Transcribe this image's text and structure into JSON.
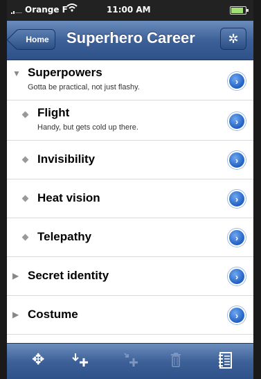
{
  "status_bar": {
    "carrier": "Orange F",
    "time": "11:00 AM",
    "wifi_icon": "wifi-icon",
    "battery_icon": "battery-icon"
  },
  "nav": {
    "back_label": "Home",
    "title": "Superhero Career",
    "settings_icon": "gear-icon"
  },
  "list": {
    "rows": [
      {
        "title": "Superpowers",
        "subtitle": "Gotta be practical, not just flashy.",
        "marker": "expanded-triangle",
        "level": 0
      },
      {
        "title": "Flight",
        "subtitle": "Handy, but gets cold up there.",
        "marker": "diamond",
        "level": 1
      },
      {
        "title": "Invisibility",
        "subtitle": "",
        "marker": "diamond",
        "level": 1
      },
      {
        "title": "Heat vision",
        "subtitle": "",
        "marker": "diamond",
        "level": 1
      },
      {
        "title": "Telepathy",
        "subtitle": "",
        "marker": "diamond",
        "level": 1
      },
      {
        "title": "Secret identity",
        "subtitle": "",
        "marker": "collapsed-triangle",
        "level": 0
      },
      {
        "title": "Costume",
        "subtitle": "",
        "marker": "collapsed-triangle",
        "level": 0
      }
    ]
  },
  "toolbar": {
    "items": [
      {
        "icon": "move-icon",
        "enabled": true
      },
      {
        "icon": "add-child-icon",
        "enabled": true
      },
      {
        "icon": "add-sibling-icon",
        "enabled": false
      },
      {
        "icon": "trash-icon",
        "enabled": false
      },
      {
        "icon": "notes-icon",
        "enabled": true
      }
    ]
  },
  "colors": {
    "nav_blue": "#3d6098",
    "disclosure_blue": "#1f5fc4"
  }
}
